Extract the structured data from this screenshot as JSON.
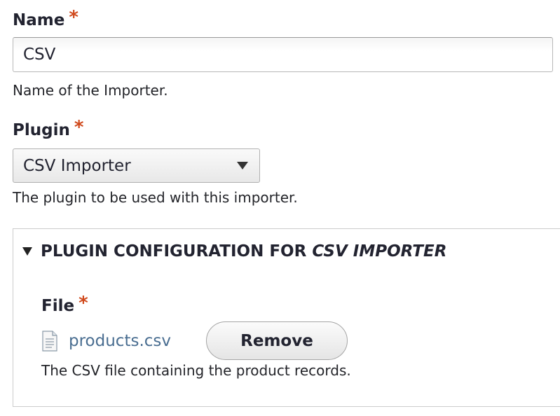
{
  "name_field": {
    "label": "Name",
    "required_mark": "*",
    "value": "CSV",
    "description": "Name of the Importer."
  },
  "plugin_field": {
    "label": "Plugin",
    "required_mark": "*",
    "selected": "CSV Importer",
    "description": "The plugin to be used with this importer."
  },
  "config": {
    "legend_prefix": "PLUGIN CONFIGURATION FOR",
    "legend_emphasis": "CSV IMPORTER",
    "file": {
      "label": "File",
      "required_mark": "*",
      "filename": "products.csv",
      "remove_label": "Remove",
      "description": "The CSV file containing the product records."
    }
  },
  "icons": {
    "file": "file-icon",
    "select_arrow": "chevron-down-icon",
    "collapse": "triangle-down-icon"
  },
  "colors": {
    "required": "#d0491c",
    "link": "#4a6e91",
    "text": "#222330"
  }
}
